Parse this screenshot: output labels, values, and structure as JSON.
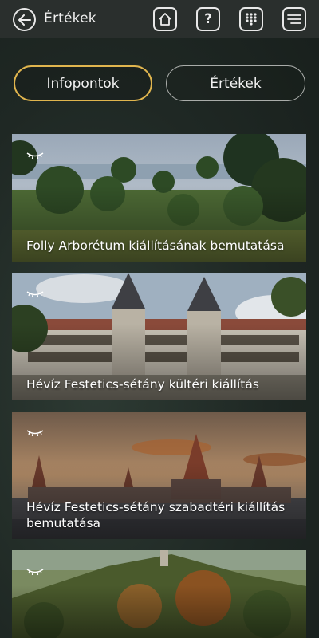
{
  "header": {
    "title": "Értékek",
    "icons": [
      "back-arrow-icon",
      "home-icon",
      "help-icon",
      "grid-icon",
      "menu-icon"
    ]
  },
  "tabs": [
    {
      "label": "Infopontok",
      "active": true
    },
    {
      "label": "Értékek",
      "active": false
    }
  ],
  "cards": [
    {
      "title": "Folly Arborétum kiállításának bemutatása",
      "icon": "eye-closed-icon"
    },
    {
      "title": "Hévíz Festetics-sétány kültéri kiállítás",
      "icon": "eye-closed-icon"
    },
    {
      "title": "Hévíz Festetics-sétány szabadtéri kiállítás bemutatása",
      "icon": "eye-closed-icon"
    },
    {
      "title": "",
      "icon": "eye-closed-icon"
    }
  ],
  "colors": {
    "active_tab_border": "#e0b54e",
    "topbar": "#2a2f2d",
    "background": "#1f2824"
  }
}
